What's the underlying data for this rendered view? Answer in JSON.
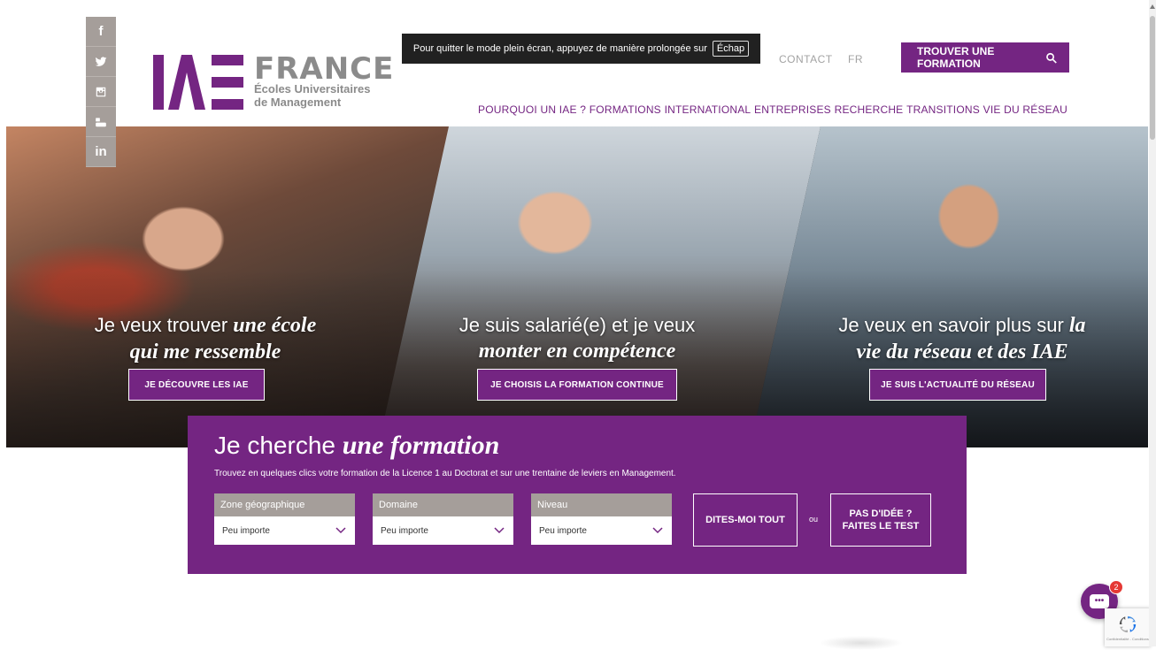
{
  "social": [
    {
      "icon": "facebook-icon",
      "glyph": "f"
    },
    {
      "icon": "twitter-icon",
      "glyph": ""
    },
    {
      "icon": "instagram-icon",
      "glyph": ""
    },
    {
      "icon": "youtube-icon",
      "glyph": ""
    },
    {
      "icon": "linkedin-icon",
      "glyph": "in"
    }
  ],
  "logo": {
    "brand": "FRANCE",
    "line1": "Écoles Universitaires",
    "line2": "de Management"
  },
  "fullscreen_notice": {
    "text": "Pour quitter le mode plein écran, appuyez de manière prolongée sur",
    "key": "Échap"
  },
  "top_nav": {
    "contact": "CONTACT",
    "lang": "FR",
    "cta": "TROUVER UNE FORMATION"
  },
  "main_nav": [
    "POURQUOI UN IAE ?",
    "FORMATIONS",
    "INTERNATIONAL",
    "ENTREPRISES",
    "RECHERCHE",
    "TRANSITIONS",
    "VIE DU RÉSEAU"
  ],
  "hero": {
    "panels": [
      {
        "line1": "Je veux trouver ",
        "em1": "une école",
        "em2": "qui me ressemble",
        "button": "JE DÉCOUVRE LES IAE"
      },
      {
        "line1": "Je suis salarié(e) et je veux",
        "em1": "",
        "em2": "monter en compétence",
        "button": "JE CHOISIS LA FORMATION CONTINUE"
      },
      {
        "line1": "Je veux en savoir plus sur ",
        "em1": "la",
        "em2": "vie du réseau et des IAE",
        "button": "JE SUIS L'ACTUALITÉ DU RÉSEAU"
      }
    ]
  },
  "search": {
    "title_plain": "Je cherche ",
    "title_em": "une formation",
    "subtitle": "Trouvez en quelques clics votre formation de la Licence 1 au Doctorat et sur une trentaine de leviers en Management.",
    "filters": [
      {
        "label": "Zone géographique",
        "value": "Peu importe"
      },
      {
        "label": "Domaine",
        "value": "Peu importe"
      },
      {
        "label": "Niveau",
        "value": "Peu importe"
      }
    ],
    "submit": "DITES-MOI TOUT",
    "or": "ou",
    "test_line1": "PAS D'IDÉE ?",
    "test_line2": "FAITES LE TEST"
  },
  "chat": {
    "badge": "2",
    "glyph": "•••"
  },
  "recaptcha": {
    "text": "Confidentialité - Conditions"
  },
  "colors": {
    "brand": "#742582",
    "grey": "#a59e9a"
  }
}
